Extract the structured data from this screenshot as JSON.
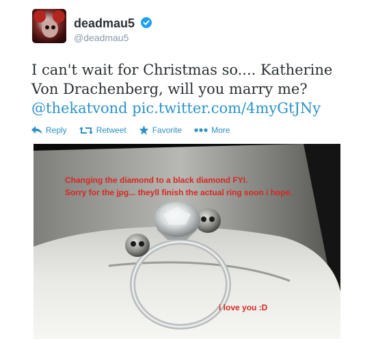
{
  "author": {
    "display_name": "deadmau5",
    "handle": "@deadmau5",
    "verified": true,
    "avatar_icon": "deadmau5-avatar-icon"
  },
  "tweet": {
    "text_line1": "I can't wait for Christmas so.... Katherine",
    "text_line2": "Von Drachenberg, will you marry me?",
    "mention": "@thekatvond",
    "pic_link": "pic.twitter.com/4myGtJNy"
  },
  "actions": {
    "reply": "Reply",
    "retweet": "Retweet",
    "favorite": "Favorite",
    "more": "More"
  },
  "photo": {
    "caption_line1": "Changing the diamond to a black diamond FYI.",
    "caption_line2": "Sorry for the jpg... theyll finish the actual ring soon i hope.",
    "caption_line3": "i love you :D"
  },
  "colors": {
    "link": "#2a91c6",
    "caption": "#d8271f",
    "verified": "#1da1f2"
  }
}
